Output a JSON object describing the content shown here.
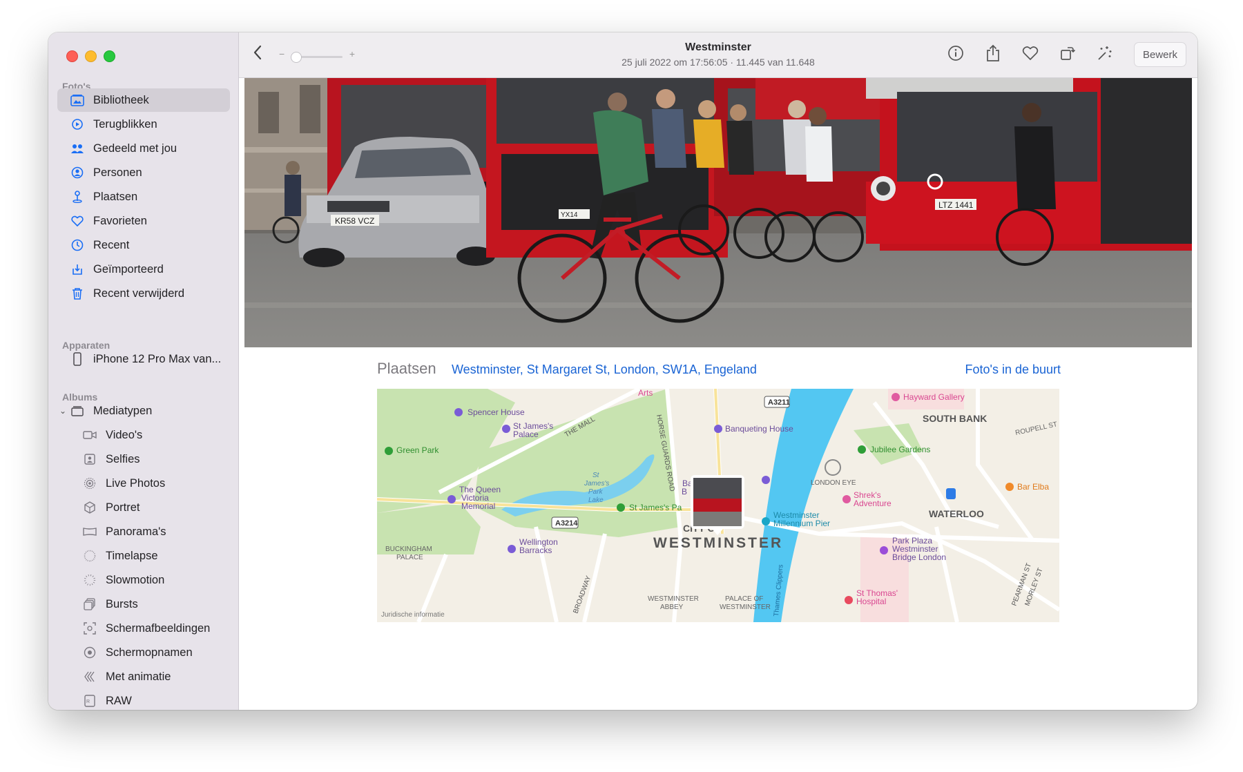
{
  "window": {
    "title": "Westminster",
    "subtitle": "25 juli 2022 om 17:56:05  ·  11.445 van 11.648"
  },
  "toolbar": {
    "edit_label": "Bewerk",
    "zoom_minus": "−",
    "zoom_plus": "+",
    "zoom_level": 0.05
  },
  "sidebar": {
    "section_photos": "Foto's",
    "library": [
      {
        "label": "Bibliotheek",
        "icon": "library-icon",
        "selected": true
      },
      {
        "label": "Terugblikken",
        "icon": "memories-icon"
      },
      {
        "label": "Gedeeld met jou",
        "icon": "shared-icon"
      },
      {
        "label": "Personen",
        "icon": "people-icon"
      },
      {
        "label": "Plaatsen",
        "icon": "places-icon"
      },
      {
        "label": "Favorieten",
        "icon": "heart-icon"
      },
      {
        "label": "Recent",
        "icon": "clock-icon"
      },
      {
        "label": "Geïmporteerd",
        "icon": "import-icon"
      },
      {
        "label": "Recent verwijderd",
        "icon": "trash-icon"
      }
    ],
    "section_devices": "Apparaten",
    "device": "iPhone 12 Pro Max van...",
    "section_albums": "Albums",
    "mediatypes": "Mediatypen",
    "media": [
      {
        "label": "Video's",
        "icon": "video-icon"
      },
      {
        "label": "Selfies",
        "icon": "selfie-icon"
      },
      {
        "label": "Live Photos",
        "icon": "live-photo-icon"
      },
      {
        "label": "Portret",
        "icon": "portrait-icon"
      },
      {
        "label": "Panorama's",
        "icon": "panorama-icon"
      },
      {
        "label": "Timelapse",
        "icon": "timelapse-icon"
      },
      {
        "label": "Slowmotion",
        "icon": "slowmotion-icon"
      },
      {
        "label": "Bursts",
        "icon": "bursts-icon"
      },
      {
        "label": "Schermafbeeldingen",
        "icon": "screenshot-icon"
      },
      {
        "label": "Schermopnamen",
        "icon": "screen-recording-icon"
      },
      {
        "label": "Met animatie",
        "icon": "animated-icon"
      },
      {
        "label": "RAW",
        "icon": "raw-icon"
      }
    ]
  },
  "places": {
    "label": "Plaatsen",
    "address": "Westminster, St Margaret St, London, SW1A, Engeland",
    "nearby": "Foto's in de buurt"
  },
  "map": {
    "labels": {
      "arts": "Arts",
      "spencer": "Spencer House",
      "stjames_palace1": "St James's",
      "stjames_palace2": "Palace",
      "the_mall": "THE MALL",
      "horse_guards": "HORSE GUARDS ROAD",
      "a3211": "A3211",
      "banqueting": "Banqueting House",
      "hayward": "Hayward Gallery",
      "south_bank": "SOUTH BANK",
      "roupell": "ROUPELL ST",
      "green_park": "Green Park",
      "jubilee": "Jubilee Gardens",
      "park_lake1": "St",
      "park_lake2": "James's",
      "park_lake3": "Park",
      "park_lake4": "Lake",
      "battle1": "Battle of",
      "battle2": "ent",
      "b_letter": "B",
      "london_eye": "LONDON EYE",
      "shrek1": "Shrek's",
      "shrek2": "Adventure",
      "bar_elba": "Bar Elba",
      "waterloo": "WATERLOO",
      "queen1": "The Queen",
      "queen2": "Victoria",
      "queen3": "Memorial",
      "stjames_park": "St James's Pa",
      "westminster_pier1": "Westminster",
      "westminster_pier2": "Millennium Pier",
      "city_of": "CITY OF",
      "westminster": "WESTMINSTER",
      "park_plaza1": "Park Plaza",
      "park_plaza2": "Westminster",
      "park_plaza3": "Bridge London",
      "buckingham1": "BUCKINGHAM",
      "buckingham2": "PALACE",
      "a3214": "A3214",
      "wellington1": "Wellington",
      "wellington2": "Barracks",
      "broadway": "BROADWAY",
      "abbey1": "WESTMINSTER",
      "abbey2": "ABBEY",
      "palace1": "PALACE OF",
      "palace2": "WESTMINSTER",
      "thames": "Thames Clippers",
      "st_thomas1": "St Thomas'",
      "st_thomas2": "Hospital",
      "pearman": "PEARMAN ST",
      "morley": "MORLEY ST",
      "legal": "Juridische informatie"
    }
  },
  "photo": {
    "plates": {
      "car": "KR58 VCZ",
      "bus": "LTZ 1441",
      "bus_left": "YX14"
    }
  },
  "colors": {
    "accent": "#1a6ef5",
    "link": "#1a64d4",
    "sidebar_bg": "#e7e3ea"
  }
}
